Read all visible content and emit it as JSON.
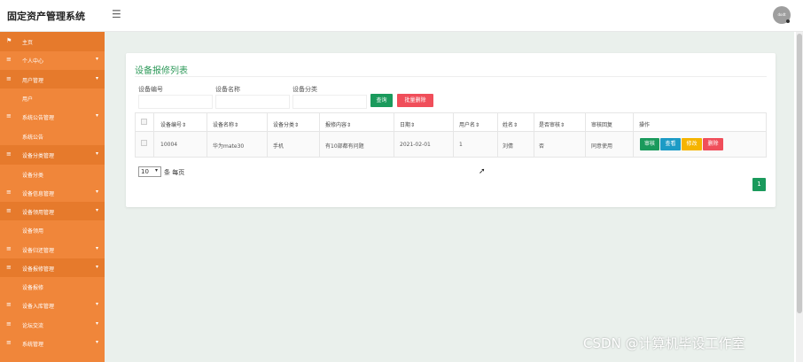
{
  "app": {
    "title": "固定资产管理系统",
    "avatar_text": "dodt"
  },
  "sidebar": {
    "items": [
      {
        "label": "主页",
        "icon": "flag-icon",
        "type": "main"
      },
      {
        "label": "个人中心",
        "icon": "menu-lines-icon",
        "type": "group",
        "arrow": "▾"
      },
      {
        "label": "用户管理",
        "icon": "menu-lines-icon",
        "type": "group",
        "arrow": "▾"
      },
      {
        "label": "用户",
        "type": "sub"
      },
      {
        "label": "系统公告管理",
        "icon": "menu-lines-icon",
        "type": "group",
        "arrow": "▾"
      },
      {
        "label": "系统公告",
        "type": "sub"
      },
      {
        "label": "设备分类管理",
        "icon": "menu-lines-icon",
        "type": "group",
        "arrow": "▾"
      },
      {
        "label": "设备分类",
        "type": "sub"
      },
      {
        "label": "设备信息管理",
        "icon": "menu-lines-icon",
        "type": "group",
        "arrow": "▾"
      },
      {
        "label": "设备领用管理",
        "icon": "menu-lines-icon",
        "type": "group",
        "arrow": "▾"
      },
      {
        "label": "设备领用",
        "type": "sub"
      },
      {
        "label": "设备归还管理",
        "icon": "menu-lines-icon",
        "type": "group",
        "arrow": "▾"
      },
      {
        "label": "设备报修管理",
        "icon": "menu-lines-icon",
        "type": "group",
        "arrow": "▾"
      },
      {
        "label": "设备报修",
        "type": "sub"
      },
      {
        "label": "设备入库管理",
        "icon": "menu-lines-icon",
        "type": "group",
        "arrow": "▾"
      },
      {
        "label": "论坛交流",
        "icon": "menu-lines-icon",
        "type": "group",
        "arrow": "▾"
      },
      {
        "label": "系统管理",
        "icon": "menu-lines-icon",
        "type": "group",
        "arrow": "▾"
      }
    ]
  },
  "page": {
    "title": "设备报修列表",
    "filters": {
      "equipment_no_label": "设备编号",
      "equipment_name_label": "设备名称",
      "category_label": "设备分类",
      "equipment_no_value": "",
      "equipment_name_value": "",
      "category_value": ""
    },
    "buttons": {
      "query": "查询",
      "batch_delete": "批量删除"
    },
    "table": {
      "columns": [
        "设备编号⇕",
        "设备名称⇕",
        "设备分类⇕",
        "报修内容⇕",
        "日期⇕",
        "用户名⇕",
        "姓名⇕",
        "是否审核⇕",
        "审核回复",
        "操作"
      ],
      "rows": [
        {
          "equipment_no": "10004",
          "equipment_name": "华为mate30",
          "category": "手机",
          "content": "有10部都有问题",
          "date": "2021-02-01",
          "username": "1",
          "name": "刘倩",
          "reviewed": "否",
          "reply": "同意使用"
        }
      ],
      "row_actions": {
        "audit": "审核",
        "view": "查看",
        "edit": "修改",
        "delete": "删除"
      }
    },
    "pagination": {
      "page_size": "10",
      "page_size_label": "条 每页",
      "current_page": "1"
    }
  },
  "watermark": "CSDN @计算机毕设工作室",
  "colors": {
    "sidebar": "#f0863a",
    "primary_green": "#1a9a5c",
    "danger": "#f04e5a",
    "info": "#1c9bc5",
    "warning": "#f5b400"
  }
}
